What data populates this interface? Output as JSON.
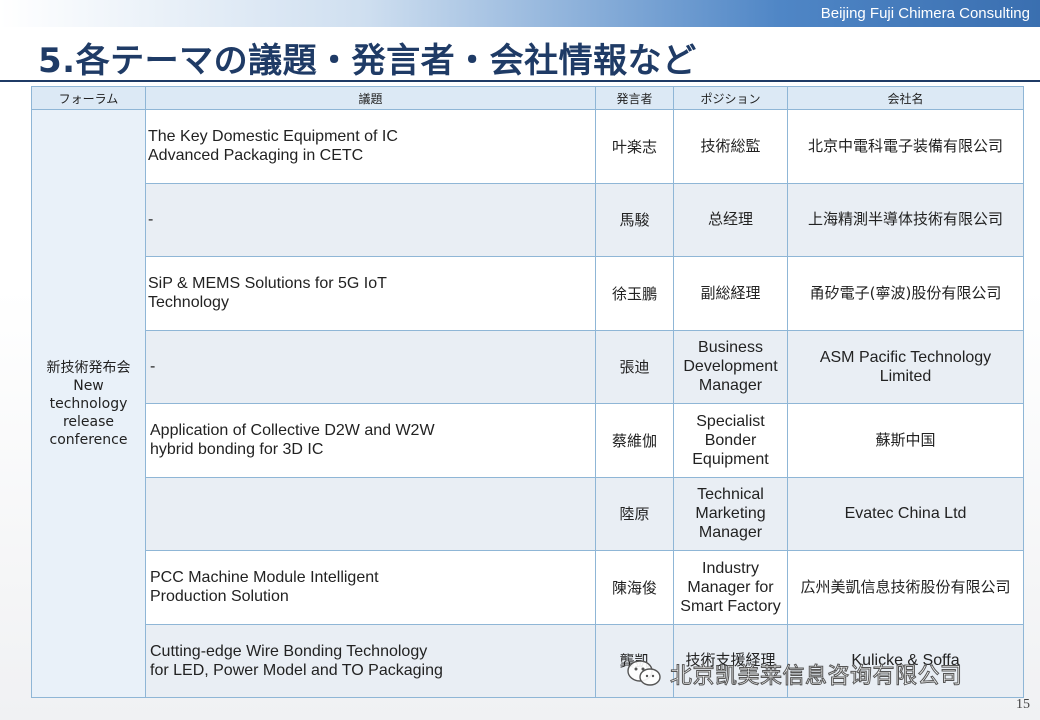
{
  "header": {
    "company": "Beijing Fuji Chimera Consulting",
    "title": "5.各テーマの議題・発言者・会社情報など"
  },
  "table": {
    "columns": [
      "フォーラム",
      "議題",
      "発言者",
      "ポジション",
      "会社名"
    ],
    "forum": [
      "新技術発布会",
      "New",
      "technology",
      "release",
      "conference"
    ],
    "rows": [
      {
        "topic": [
          "The Key Domestic Equipment of IC",
          "Advanced Packaging in CETC"
        ],
        "speaker": "叶楽志",
        "position": [
          "技術総監"
        ],
        "company": [
          "北京中電科電子装備有限公司"
        ]
      },
      {
        "topic": [
          "-"
        ],
        "speaker": "馬駿",
        "position": [
          "总经理"
        ],
        "company": [
          "上海精測半導体技術有限公司"
        ]
      },
      {
        "topic": [
          "SiP & MEMS Solutions for 5G IoT",
          "Technology"
        ],
        "speaker": "徐玉鵬",
        "position": [
          "副総経理"
        ],
        "company": [
          "甬矽電子(寧波)股份有限公司"
        ]
      },
      {
        "topic": [
          "-"
        ],
        "speaker": "張迪",
        "position": [
          "Business",
          "Development",
          "Manager"
        ],
        "company": [
          "ASM Pacific Technology",
          "Limited"
        ]
      },
      {
        "topic": [
          "Application of Collective D2W and W2W",
          "hybrid bonding for 3D IC"
        ],
        "speaker": "蔡維伽",
        "position": [
          "Specialist",
          "Bonder",
          "Equipment"
        ],
        "company": [
          "蘇斯中国"
        ]
      },
      {
        "topic": [
          ""
        ],
        "speaker": "陸原",
        "position": [
          "Technical",
          "Marketing",
          "Manager"
        ],
        "company": [
          "Evatec  China Ltd"
        ]
      },
      {
        "topic": [
          "PCC Machine Module Intelligent",
          "Production Solution"
        ],
        "speaker": "陳海俊",
        "position": [
          "Industry",
          "Manager for",
          "Smart Factory"
        ],
        "company": [
          "広州美凱信息技術股份有限公司"
        ]
      },
      {
        "topic": [
          "Cutting-edge Wire Bonding Technology",
          "for LED, Power Model and TO Packaging"
        ],
        "speaker": "龔凱",
        "position": [
          "技術支援経理"
        ],
        "company": [
          "Kulicke & Soffa"
        ]
      }
    ]
  },
  "watermark": {
    "text": "北京凯美莱信息咨询有限公司",
    "icon": "wechat-icon"
  },
  "page_number": "15"
}
